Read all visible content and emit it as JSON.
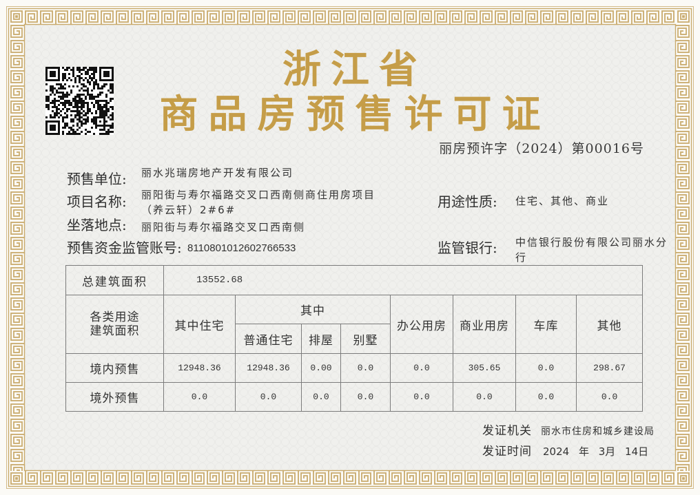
{
  "colors": {
    "title_gold": "#c59d48",
    "border_gold": "#c9aa6c",
    "ink": "#333333",
    "table_line": "#7b7b7b"
  },
  "header": {
    "province": "浙江省",
    "title": "商品房预售许可证",
    "permit_number": "丽房预许字（2024）第00016号"
  },
  "details": {
    "presale_unit": {
      "label": "预售单位:",
      "value": "丽水兆瑞房地产开发有限公司"
    },
    "project_name": {
      "label": "项目名称:",
      "value_lines": [
        "丽阳街与寿尔福路交叉口西南侧商住用房项目",
        "（养云轩）2#6#"
      ]
    },
    "location": {
      "label": "坐落地点:",
      "value": "丽阳街与寿尔福路交叉口西南侧"
    },
    "escrow_account": {
      "label": "预售资金监管账号:",
      "value": "8110801012602766533"
    },
    "usage": {
      "label": "用途性质:",
      "value": "住宅、其他、商业"
    },
    "supervising_bank": {
      "label": "监管银行:",
      "value_lines": [
        "中信银行股份有限公司丽水分",
        "行"
      ]
    }
  },
  "area_table": {
    "total_label": "总建筑面积",
    "total_value": "13552.68",
    "headers": {
      "category": [
        "各类用途",
        "建筑面积"
      ],
      "residential_total": "其中住宅",
      "of_which": "其中",
      "ordinary_housing": "普通住宅",
      "townhouse": "排屋",
      "villa": "别墅",
      "office": "办公用房",
      "commercial": "商业用房",
      "garage": "车库",
      "other": "其他"
    },
    "rows": [
      {
        "label": "境内预售",
        "values": [
          "12948.36",
          "12948.36",
          "0.00",
          "0.0",
          "0.0",
          "305.65",
          "0.0",
          "298.67"
        ]
      },
      {
        "label": "境外预售",
        "values": [
          "0.0",
          "0.0",
          "0.0",
          "0.0",
          "0.0",
          "0.0",
          "0.0",
          "0.0"
        ]
      }
    ]
  },
  "footer": {
    "authority_label": "发证机关",
    "authority": "丽水市住房和城乡建设局",
    "date_label": "发证时间",
    "date": "2024 年 3月 14日"
  }
}
